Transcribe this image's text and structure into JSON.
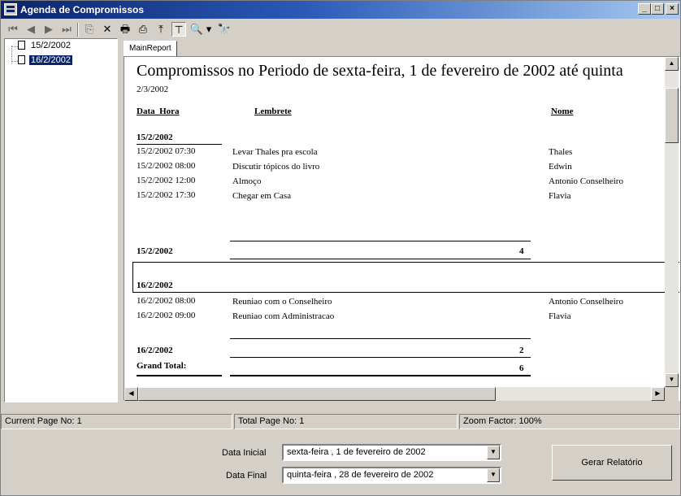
{
  "window": {
    "title": "Agenda de Compromissos",
    "min_glyph": "_",
    "max_glyph": "□",
    "close_glyph": "×"
  },
  "toolbar": {
    "icons": [
      "first-page-icon",
      "prev-page-icon",
      "next-page-icon",
      "last-page-icon",
      "goto-page-icon",
      "close-report-icon",
      "print-icon",
      "export-icon",
      "refresh-icon",
      "toggle-tree-icon",
      "zoom-icon",
      "search-icon"
    ],
    "glyphs": {
      "first": "⏮",
      "prev": "◀",
      "next": "▶",
      "last": "⏭",
      "goto": "⎘",
      "close": "✕",
      "print": "🖶",
      "export": "⎙",
      "refresh": "⤒",
      "tree": "⊤",
      "zoom": "🔍",
      "drop": "▾",
      "search": "🔭"
    }
  },
  "tree": {
    "items": [
      "15/2/2002",
      "16/2/2002"
    ],
    "selected": "16/2/2002"
  },
  "tab": {
    "label": "MainReport"
  },
  "report": {
    "title": "Compromissos no Periodo de sexta-feira, 1 de fevereiro de 2002 até quinta",
    "date": "2/3/2002",
    "columns": {
      "datetime": "Data_Hora",
      "reminder": "Lembrete",
      "name": "Nome"
    },
    "groups": [
      {
        "header": "15/2/2002",
        "rows": [
          {
            "datetime": "15/2/2002  07:30",
            "reminder": "Levar Thales pra escola",
            "name": "Thales"
          },
          {
            "datetime": "15/2/2002  08:00",
            "reminder": "Discutir tópicos do livro",
            "name": "Edwin"
          },
          {
            "datetime": "15/2/2002  12:00",
            "reminder": "Almoço",
            "name": "Antonio Conselheiro"
          },
          {
            "datetime": "15/2/2002  17:30",
            "reminder": "Chegar em Casa",
            "name": "Flavia"
          }
        ],
        "footer": "15/2/2002",
        "count": "4"
      },
      {
        "header": "16/2/2002",
        "rows": [
          {
            "datetime": "16/2/2002  08:00",
            "reminder": "Reuniao com o Conselheiro",
            "name": "Antonio Conselheiro"
          },
          {
            "datetime": "16/2/2002  09:00",
            "reminder": "Reuniao com Administracao",
            "name": "Flavia"
          }
        ],
        "footer": "16/2/2002",
        "count": "2"
      }
    ],
    "grand_total_label": "Grand Total:",
    "grand_total": "6"
  },
  "status": {
    "current_page": "Current Page No: 1",
    "total_page": "Total Page No: 1",
    "zoom": "Zoom Factor: 100%"
  },
  "form": {
    "start_label": "Data Inicial",
    "start_value": "sexta-feira  ,  1 de  fevereiro  de 2002",
    "end_label": "Data Final",
    "end_value": "quinta-feira  , 28 de  fevereiro  de 2002",
    "generate_button": "Gerar Relatório"
  },
  "colors": {
    "title_start": "#0a246a",
    "title_end": "#a6caf0",
    "face": "#d4d0c8",
    "selection": "#0a246a"
  }
}
